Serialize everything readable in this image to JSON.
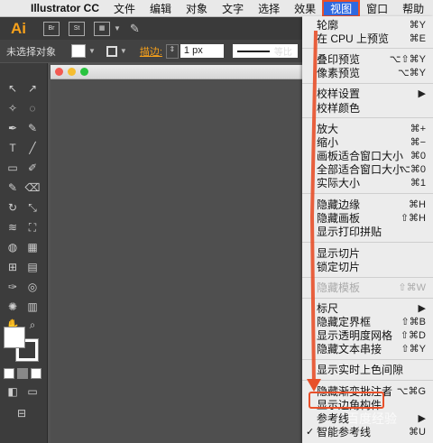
{
  "menubar": {
    "app": "Illustrator CC",
    "items": [
      "文件",
      "编辑",
      "对象",
      "文字",
      "选择",
      "效果",
      "视图",
      "窗口",
      "帮助"
    ],
    "active": "视图"
  },
  "appbar": {
    "logo": "Ai",
    "btn1": "Br",
    "btn2": "St"
  },
  "control": {
    "selection_label": "未选择对象",
    "stroke_label": "描边:",
    "stroke_value": "1 px",
    "line_label": "等比"
  },
  "view_menu": {
    "items": [
      {
        "label": "轮廓",
        "key": "⌘Y"
      },
      {
        "label": "在 CPU 上预览",
        "key": "⌘E"
      },
      {
        "label": "叠印预览",
        "key": "⌥⇧⌘Y"
      },
      {
        "label": "像素预览",
        "key": "⌥⌘Y"
      },
      {
        "label": "校样设置",
        "key": "▶"
      },
      {
        "label": "校样颜色",
        "key": ""
      },
      {
        "label": "放大",
        "key": "⌘+"
      },
      {
        "label": "缩小",
        "key": "⌘−"
      },
      {
        "label": "画板适合窗口大小",
        "key": "⌘0"
      },
      {
        "label": "全部适合窗口大小",
        "key": "⌥⌘0"
      },
      {
        "label": "实际大小",
        "key": "⌘1"
      },
      {
        "label": "隐藏边缘",
        "key": "⌘H"
      },
      {
        "label": "隐藏画板",
        "key": "⇧⌘H"
      },
      {
        "label": "显示打印拼贴",
        "key": ""
      },
      {
        "label": "显示切片",
        "key": ""
      },
      {
        "label": "锁定切片",
        "key": ""
      },
      {
        "label": "隐藏模板",
        "key": "⇧⌘W"
      },
      {
        "label": "标尺",
        "key": "▶"
      },
      {
        "label": "隐藏定界框",
        "key": "⇧⌘B"
      },
      {
        "label": "显示透明度网格",
        "key": "⇧⌘D"
      },
      {
        "label": "隐藏文本串接",
        "key": "⇧⌘Y"
      },
      {
        "label": "显示实时上色间隙",
        "key": ""
      },
      {
        "label": "隐藏渐变批注者",
        "key": "⌥⌘G"
      },
      {
        "label": "显示边角构件",
        "key": ""
      },
      {
        "label": "参考线",
        "key": "▶"
      },
      {
        "label": "智能参考线",
        "key": "⌘U"
      }
    ],
    "checked_item": "智能参考线"
  },
  "watermark": "百度经验",
  "colors": {
    "accent": "#2f69e0",
    "annotation": "#e8502a",
    "logo": "#f7a11b"
  }
}
